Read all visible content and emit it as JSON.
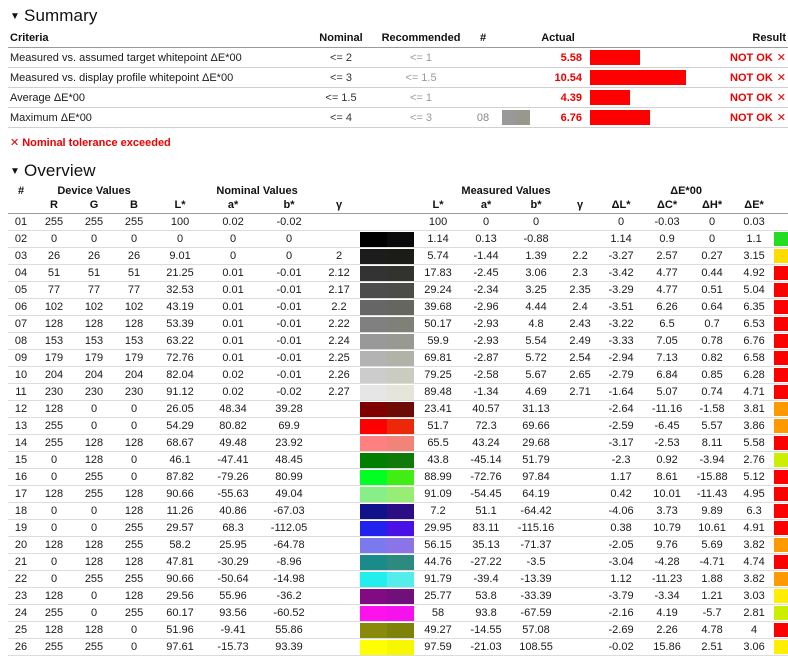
{
  "summary": {
    "heading": "Summary",
    "triangle": "▼",
    "columns": [
      "Criteria",
      "Nominal",
      "Recommended",
      "#",
      "Actual",
      "",
      "Result"
    ],
    "rows": [
      {
        "criteria": "Measured vs. assumed target whitepoint ΔE*00",
        "nominal": "<= 2",
        "recommended": "<= 1",
        "num": "",
        "actual": "5.58",
        "bar_pct": 48,
        "swatch": null,
        "result": "NOT OK",
        "result_mark": "✕"
      },
      {
        "criteria": "Measured vs. display profile whitepoint ΔE*00",
        "nominal": "<= 3",
        "recommended": "<= 1.5",
        "num": "",
        "actual": "10.54",
        "bar_pct": 92,
        "swatch": null,
        "result": "NOT OK",
        "result_mark": "✕"
      },
      {
        "criteria": "Average ΔE*00",
        "nominal": "<= 1.5",
        "recommended": "<= 1",
        "num": "",
        "actual": "4.39",
        "bar_pct": 38,
        "swatch": null,
        "result": "NOT OK",
        "result_mark": "✕"
      },
      {
        "criteria": "Maximum ΔE*00",
        "nominal": "<= 4",
        "recommended": "<= 3",
        "num": "08",
        "actual": "6.76",
        "bar_pct": 58,
        "swatch": [
          "#999999",
          "#98998c"
        ],
        "result": "NOT OK",
        "result_mark": "✕"
      }
    ],
    "legend": {
      "mark": "✕",
      "text": "Nominal tolerance exceeded"
    }
  },
  "overview": {
    "heading": "Overview",
    "triangle": "▼",
    "groups": [
      {
        "label": "#",
        "span": 1
      },
      {
        "label": "Device Values",
        "span": 3
      },
      {
        "label": "Nominal Values",
        "span": 4
      },
      {
        "label": "",
        "span": 1
      },
      {
        "label": "Measured Values",
        "span": 4
      },
      {
        "label": "ΔE*00",
        "span": 4
      },
      {
        "label": "",
        "span": 1
      }
    ],
    "columns": [
      "",
      "R",
      "G",
      "B",
      "L*",
      "a*",
      "b*",
      "γ",
      "",
      "L*",
      "a*",
      "b*",
      "γ",
      "ΔL*",
      "ΔC*",
      "ΔH*",
      "ΔE*",
      ""
    ],
    "rows": [
      {
        "idx": "01",
        "R": "255",
        "G": "255",
        "B": "255",
        "nL": "100",
        "na": "0.02",
        "nb": "-0.02",
        "ng": "",
        "swatch": null,
        "mL": "100",
        "ma": "0",
        "mb": "0",
        "mg": "",
        "dL": "0",
        "dC": "-0.03",
        "dH": "0",
        "dE": "0.03",
        "dE_class": "de-good",
        "bar_pct": 0,
        "bar_color": "#ffffff"
      },
      {
        "idx": "02",
        "R": "0",
        "G": "0",
        "B": "0",
        "nL": "0",
        "na": "0",
        "nb": "0",
        "ng": "",
        "swatch": [
          "#000000",
          "#090909"
        ],
        "mL": "1.14",
        "ma": "0.13",
        "mb": "-0.88",
        "mg": "",
        "dL": "1.14",
        "dC": "0.9",
        "dH": "0",
        "dE": "1.1",
        "dE_class": "de-good",
        "bar_pct": 16,
        "bar_color": "#22dd22"
      },
      {
        "idx": "03",
        "R": "26",
        "G": "26",
        "B": "26",
        "nL": "9.01",
        "na": "0",
        "nb": "0",
        "ng": "2",
        "swatch": [
          "#1d1c1c",
          "#1b1c18"
        ],
        "mL": "5.74",
        "ma": "-1.44",
        "mb": "1.39",
        "mg": "2.2",
        "dL": "-3.27",
        "dC": "2.57",
        "dH": "0.27",
        "dE": "3.15",
        "dE_class": "de-good",
        "bar_pct": 37,
        "bar_color": "#ffdd00"
      },
      {
        "idx": "04",
        "R": "51",
        "G": "51",
        "B": "51",
        "nL": "21.25",
        "na": "0.01",
        "nb": "-0.01",
        "ng": "2.12",
        "swatch": [
          "#333333",
          "#32332e"
        ],
        "mL": "17.83",
        "ma": "-2.45",
        "mb": "3.06",
        "mg": "2.3",
        "dL": "-3.42",
        "dC": "4.77",
        "dH": "0.44",
        "dE": "4.92",
        "dE_class": "de-bad",
        "bar_pct": 67,
        "bar_color": "#ff0000"
      },
      {
        "idx": "05",
        "R": "77",
        "G": "77",
        "B": "77",
        "nL": "32.53",
        "na": "0.01",
        "nb": "-0.01",
        "ng": "2.17",
        "swatch": [
          "#4d4d4d",
          "#4c4d47"
        ],
        "mL": "29.24",
        "ma": "-2.34",
        "mb": "3.25",
        "mg": "2.35",
        "dL": "-3.29",
        "dC": "4.77",
        "dH": "0.51",
        "dE": "5.04",
        "dE_class": "de-bad",
        "bar_pct": 67,
        "bar_color": "#ff0000"
      },
      {
        "idx": "06",
        "R": "102",
        "G": "102",
        "B": "102",
        "nL": "43.19",
        "na": "0.01",
        "nb": "-0.01",
        "ng": "2.2",
        "swatch": [
          "#666666",
          "#65665f"
        ],
        "mL": "39.68",
        "ma": "-2.96",
        "mb": "4.44",
        "mg": "2.4",
        "dL": "-3.51",
        "dC": "6.26",
        "dH": "0.64",
        "dE": "6.35",
        "dE_class": "de-bad",
        "bar_pct": 82,
        "bar_color": "#ff0000"
      },
      {
        "idx": "07",
        "R": "128",
        "G": "128",
        "B": "128",
        "nL": "53.39",
        "na": "0.01",
        "nb": "-0.01",
        "ng": "2.22",
        "swatch": [
          "#808080",
          "#7f8078"
        ],
        "mL": "50.17",
        "ma": "-2.93",
        "mb": "4.8",
        "mg": "2.43",
        "dL": "-3.22",
        "dC": "6.5",
        "dH": "0.7",
        "dE": "6.53",
        "dE_class": "de-bad",
        "bar_pct": 83,
        "bar_color": "#ff0000"
      },
      {
        "idx": "08",
        "R": "153",
        "G": "153",
        "B": "153",
        "nL": "63.22",
        "na": "0.01",
        "nb": "-0.01",
        "ng": "2.24",
        "swatch": [
          "#999999",
          "#989990"
        ],
        "mL": "59.9",
        "ma": "-2.93",
        "mb": "5.54",
        "mg": "2.49",
        "dL": "-3.33",
        "dC": "7.05",
        "dH": "0.78",
        "dE": "6.76",
        "dE_class": "de-bad",
        "bar_pct": 92,
        "bar_color": "#ff0000"
      },
      {
        "idx": "09",
        "R": "179",
        "G": "179",
        "B": "179",
        "nL": "72.76",
        "na": "0.01",
        "nb": "-0.01",
        "ng": "2.25",
        "swatch": [
          "#b3b3b3",
          "#b2b3a8"
        ],
        "mL": "69.81",
        "ma": "-2.87",
        "mb": "5.72",
        "mg": "2.54",
        "dL": "-2.94",
        "dC": "7.13",
        "dH": "0.82",
        "dE": "6.58",
        "dE_class": "de-bad",
        "bar_pct": 88,
        "bar_color": "#ff0000"
      },
      {
        "idx": "10",
        "R": "204",
        "G": "204",
        "B": "204",
        "nL": "82.04",
        "na": "0.02",
        "nb": "-0.01",
        "ng": "2.26",
        "swatch": [
          "#cccccc",
          "#cbccc0"
        ],
        "mL": "79.25",
        "ma": "-2.58",
        "mb": "5.67",
        "mg": "2.65",
        "dL": "-2.79",
        "dC": "6.84",
        "dH": "0.85",
        "dE": "6.28",
        "dE_class": "de-bad",
        "bar_pct": 82,
        "bar_color": "#ff0000"
      },
      {
        "idx": "11",
        "R": "230",
        "G": "230",
        "B": "230",
        "nL": "91.12",
        "na": "0.02",
        "nb": "-0.02",
        "ng": "2.27",
        "swatch": [
          "#e6e6e6",
          "#e5e6d9"
        ],
        "mL": "89.48",
        "ma": "-1.34",
        "mb": "4.69",
        "mg": "2.71",
        "dL": "-1.64",
        "dC": "5.07",
        "dH": "0.74",
        "dE": "4.71",
        "dE_class": "de-bad",
        "bar_pct": 66,
        "bar_color": "#ff0000"
      },
      {
        "idx": "12",
        "R": "128",
        "G": "0",
        "B": "0",
        "nL": "26.05",
        "na": "48.34",
        "nb": "39.28",
        "ng": "",
        "swatch": [
          "#800000",
          "#6d0b06"
        ],
        "mL": "23.41",
        "ma": "40.57",
        "mb": "31.13",
        "mg": "",
        "dL": "-2.64",
        "dC": "-11.16",
        "dH": "-1.58",
        "dE": "3.81",
        "dE_class": "de-good",
        "bar_pct": 53,
        "bar_color": "#ff9900"
      },
      {
        "idx": "13",
        "R": "255",
        "G": "0",
        "B": "0",
        "nL": "54.29",
        "na": "80.82",
        "nb": "69.9",
        "ng": "",
        "swatch": [
          "#ff0000",
          "#ec2808"
        ],
        "mL": "51.7",
        "ma": "72.3",
        "mb": "69.66",
        "mg": "",
        "dL": "-2.59",
        "dC": "-6.45",
        "dH": "5.57",
        "dE": "3.86",
        "dE_class": "de-good",
        "bar_pct": 53,
        "bar_color": "#ff9900"
      },
      {
        "idx": "14",
        "R": "255",
        "G": "128",
        "B": "128",
        "nL": "68.67",
        "na": "49.48",
        "nb": "23.92",
        "ng": "",
        "swatch": [
          "#ff8080",
          "#f28378"
        ],
        "mL": "65.5",
        "ma": "43.24",
        "mb": "29.68",
        "mg": "",
        "dL": "-3.17",
        "dC": "-2.53",
        "dH": "8.11",
        "dE": "5.58",
        "dE_class": "de-bad",
        "bar_pct": 73,
        "bar_color": "#ff0000"
      },
      {
        "idx": "15",
        "R": "0",
        "G": "128",
        "B": "0",
        "nL": "46.1",
        "na": "-47.41",
        "nb": "48.45",
        "ng": "",
        "swatch": [
          "#007f00",
          "#0f7a08"
        ],
        "mL": "43.8",
        "ma": "-45.14",
        "mb": "51.79",
        "mg": "",
        "dL": "-2.3",
        "dC": "0.92",
        "dH": "-3.94",
        "dE": "2.76",
        "dE_class": "de-good",
        "bar_pct": 34,
        "bar_color": "#ccee00"
      },
      {
        "idx": "16",
        "R": "0",
        "G": "255",
        "B": "0",
        "nL": "87.82",
        "na": "-79.26",
        "nb": "80.99",
        "ng": "",
        "swatch": [
          "#00ff22",
          "#41ee14"
        ],
        "mL": "88.99",
        "ma": "-72.76",
        "mb": "97.84",
        "mg": "",
        "dL": "1.17",
        "dC": "8.61",
        "dH": "-15.88",
        "dE": "5.12",
        "dE_class": "de-bad",
        "bar_pct": 70,
        "bar_color": "#ff0000"
      },
      {
        "idx": "17",
        "R": "128",
        "G": "255",
        "B": "128",
        "nL": "90.66",
        "na": "-55.63",
        "nb": "49.04",
        "ng": "",
        "swatch": [
          "#88ee88",
          "#98ee74"
        ],
        "mL": "91.09",
        "ma": "-54.45",
        "mb": "64.19",
        "mg": "",
        "dL": "0.42",
        "dC": "10.01",
        "dH": "-11.43",
        "dE": "4.95",
        "dE_class": "de-bad",
        "bar_pct": 68,
        "bar_color": "#ff0000"
      },
      {
        "idx": "18",
        "R": "0",
        "G": "0",
        "B": "128",
        "nL": "11.26",
        "na": "40.86",
        "nb": "-67.03",
        "ng": "",
        "swatch": [
          "#11118c",
          "#2b0d84"
        ],
        "mL": "7.2",
        "ma": "51.1",
        "mb": "-64.42",
        "mg": "",
        "dL": "-4.06",
        "dC": "3.73",
        "dH": "9.89",
        "dE": "6.3",
        "dE_class": "de-bad",
        "bar_pct": 95,
        "bar_color": "#ff0000"
      },
      {
        "idx": "19",
        "R": "0",
        "G": "0",
        "B": "255",
        "nL": "29.57",
        "na": "68.3",
        "nb": "-112.05",
        "ng": "",
        "swatch": [
          "#2222ee",
          "#4a11e6"
        ],
        "mL": "29.95",
        "ma": "83.11",
        "mb": "-115.16",
        "mg": "",
        "dL": "0.38",
        "dC": "10.79",
        "dH": "10.61",
        "dE": "4.91",
        "dE_class": "de-bad",
        "bar_pct": 68,
        "bar_color": "#ff0000"
      },
      {
        "idx": "20",
        "R": "128",
        "G": "128",
        "B": "255",
        "nL": "58.2",
        "na": "25.95",
        "nb": "-64.78",
        "ng": "",
        "swatch": [
          "#7a7aee",
          "#8a74e8"
        ],
        "mL": "56.15",
        "ma": "35.13",
        "mb": "-71.37",
        "mg": "",
        "dL": "-2.05",
        "dC": "9.76",
        "dH": "5.69",
        "dE": "3.82",
        "dE_class": "de-good",
        "bar_pct": 53,
        "bar_color": "#ff9900"
      },
      {
        "idx": "21",
        "R": "0",
        "G": "128",
        "B": "128",
        "nL": "47.81",
        "na": "-30.29",
        "nb": "-8.96",
        "ng": "",
        "swatch": [
          "#1b8a8a",
          "#2c8a7f"
        ],
        "mL": "44.76",
        "ma": "-27.22",
        "mb": "-3.5",
        "mg": "",
        "dL": "-3.04",
        "dC": "-4.28",
        "dH": "-4.71",
        "dE": "4.74",
        "dE_class": "de-bad",
        "bar_pct": 66,
        "bar_color": "#ff0000"
      },
      {
        "idx": "22",
        "R": "0",
        "G": "255",
        "B": "255",
        "nL": "90.66",
        "na": "-50.64",
        "nb": "-14.98",
        "ng": "",
        "swatch": [
          "#22eeee",
          "#55ecec"
        ],
        "mL": "91.79",
        "ma": "-39.4",
        "mb": "-13.39",
        "mg": "",
        "dL": "1.12",
        "dC": "-11.23",
        "dH": "1.88",
        "dE": "3.82",
        "dE_class": "de-good",
        "bar_pct": 53,
        "bar_color": "#ff9900"
      },
      {
        "idx": "23",
        "R": "128",
        "G": "0",
        "B": "128",
        "nL": "29.56",
        "na": "55.96",
        "nb": "-36.2",
        "ng": "",
        "swatch": [
          "#820a82",
          "#71107a"
        ],
        "mL": "25.77",
        "ma": "53.8",
        "mb": "-33.39",
        "mg": "",
        "dL": "-3.79",
        "dC": "-3.34",
        "dH": "1.21",
        "dE": "3.03",
        "dE_class": "de-good",
        "bar_pct": 37,
        "bar_color": "#ffee00"
      },
      {
        "idx": "24",
        "R": "255",
        "G": "0",
        "B": "255",
        "nL": "60.17",
        "na": "93.56",
        "nb": "-60.52",
        "ng": "",
        "swatch": [
          "#ff11ee",
          "#f711ee"
        ],
        "mL": "58",
        "ma": "93.8",
        "mb": "-67.59",
        "mg": "",
        "dL": "-2.16",
        "dC": "4.19",
        "dH": "-5.7",
        "dE": "2.81",
        "dE_class": "de-good",
        "bar_pct": 34,
        "bar_color": "#ccee00"
      },
      {
        "idx": "25",
        "R": "128",
        "G": "128",
        "B": "0",
        "nL": "51.96",
        "na": "-9.41",
        "nb": "55.86",
        "ng": "",
        "swatch": [
          "#8a8a0a",
          "#7e8208"
        ],
        "mL": "49.27",
        "ma": "-14.55",
        "mb": "57.08",
        "mg": "",
        "dL": "-2.69",
        "dC": "2.26",
        "dH": "4.78",
        "dE": "4",
        "dE_class": "de-bad",
        "bar_pct": 60,
        "bar_color": "#ff0000"
      },
      {
        "idx": "26",
        "R": "255",
        "G": "255",
        "B": "0",
        "nL": "97.61",
        "na": "-15.73",
        "nb": "93.39",
        "ng": "",
        "swatch": [
          "#ffff00",
          "#f7f700"
        ],
        "mL": "97.59",
        "ma": "-21.03",
        "mb": "108.55",
        "mg": "",
        "dL": "-0.02",
        "dC": "15.86",
        "dH": "2.51",
        "dE": "3.06",
        "dE_class": "de-good",
        "bar_pct": 37,
        "bar_color": "#ffee00"
      }
    ]
  }
}
